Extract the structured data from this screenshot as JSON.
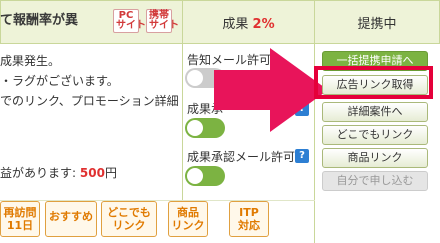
{
  "header": {
    "title_fragment": "て報酬率が異",
    "badge_pc": "PC\nサイト",
    "badge_mobile": "携帯\nサイト",
    "seika_label": "成果",
    "seika_value": "2%",
    "status": "提携中"
  },
  "description": {
    "line1": "成果発生。",
    "line2": "・ラグがございます。",
    "line3": "でのリンク、プロモーション詳細",
    "reward_prefix": "益があります:",
    "reward_value": "500",
    "reward_unit": "円"
  },
  "settings": {
    "notify_label": "告知メール許可",
    "seika_mail_label": "成果承",
    "approve_mail_label": "成果承認メール許可",
    "help": "?"
  },
  "buttons": {
    "bulk_apply": "一括提携申請へ",
    "get_ad_link": "広告リンク取得",
    "details": "詳細案件へ",
    "anywhere_link": "どこでもリンク",
    "product_link": "商品リンク",
    "self_apply": "自分で申し込む"
  },
  "tags": [
    {
      "label": "再訪問\n11日"
    },
    {
      "label": "おすすめ"
    },
    {
      "label": "どこでも\nリンク"
    },
    {
      "label": "商品\nリンク"
    },
    {
      "label": "ITP\n対応"
    }
  ],
  "colors": {
    "accent_red": "#e5003a",
    "arrow_pink": "#e8145a",
    "toggle_green": "#7cb342"
  }
}
